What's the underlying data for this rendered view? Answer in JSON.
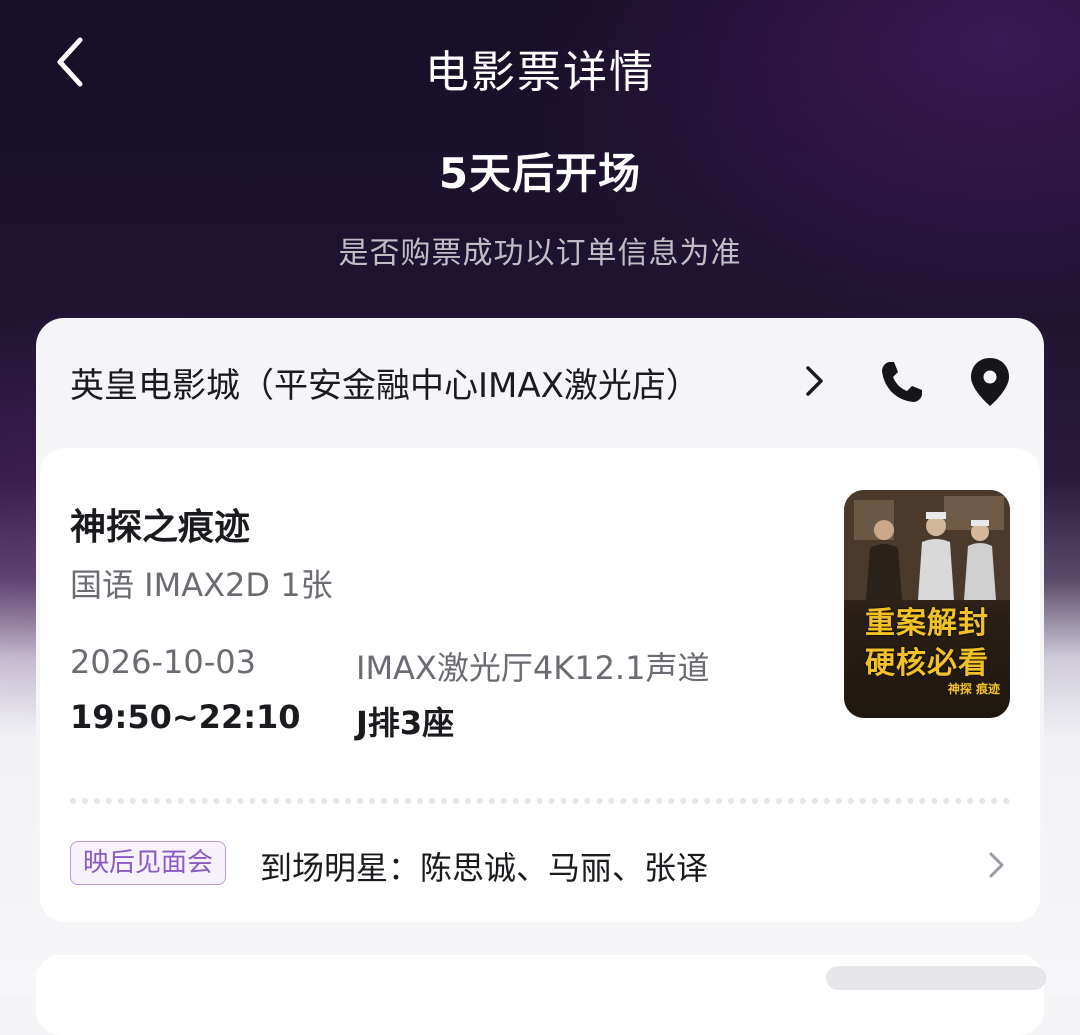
{
  "header": {
    "title": "电影票详情",
    "back_icon": "chevron-left-icon"
  },
  "status": {
    "countdown": "5天后开场",
    "notice": "是否购票成功以订单信息为准"
  },
  "cinema": {
    "name": "英皇电影城（平安金融中心IMAX激光店）",
    "phone_icon": "phone-icon",
    "map_icon": "location-pin-icon"
  },
  "movie": {
    "title": "神探之痕迹",
    "meta": "国语 IMAX2D 1张",
    "date": "2026-10-03",
    "hall": "IMAX激光厅4K12.1声道",
    "time": "19:50~22:10",
    "seat": "J排3座",
    "poster": {
      "line1": "重案解封",
      "line2": "硬核必看",
      "small": "神探 痕迹"
    }
  },
  "event": {
    "tag": "映后见面会",
    "text": "到场明星：陈思诚、马丽、张译"
  },
  "colors": {
    "accent_purple": "#8a5bc2",
    "poster_text": "#f2c126"
  }
}
